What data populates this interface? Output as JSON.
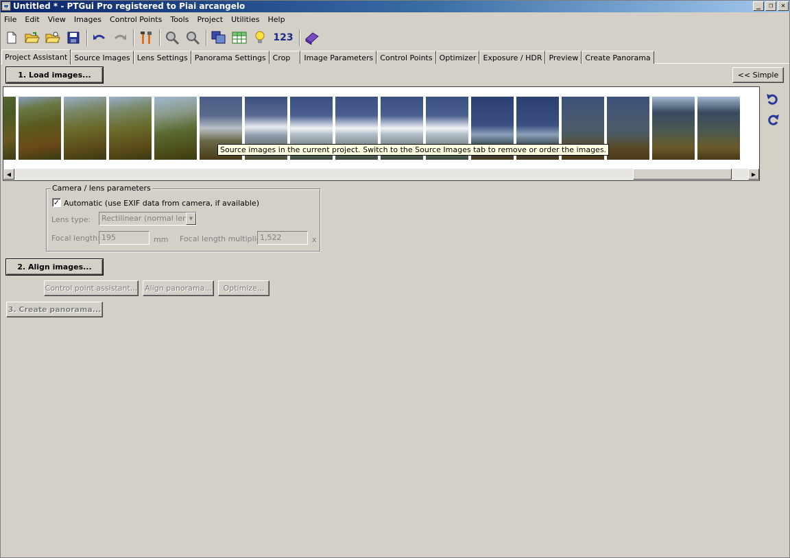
{
  "window": {
    "title": "Untitled * - PTGui Pro registered to Piai arcangelo",
    "controls": [
      "_",
      "❐",
      "✕"
    ]
  },
  "menu": [
    "File",
    "Edit",
    "View",
    "Images",
    "Control Points",
    "Tools",
    "Project",
    "Utilities",
    "Help"
  ],
  "toolbar": {
    "icons": [
      "new-icon",
      "open-icon",
      "open-recent-icon",
      "save-icon",
      "undo-icon",
      "redo-icon",
      "tools-icon",
      "zoom-in-icon",
      "zoom-out-icon",
      "panorama-editor-icon",
      "table-icon",
      "tips-icon",
      "numbering-icon",
      "help-book-icon"
    ],
    "numbering_label": "123"
  },
  "tabs": [
    "Project Assistant",
    "Source Images",
    "Lens Settings",
    "Panorama Settings",
    "Crop",
    "Image Parameters",
    "Control Points",
    "Optimizer",
    "Exposure / HDR",
    "Preview",
    "Create Panorama"
  ],
  "active_tab": "Project Assistant",
  "buttons": {
    "load_images": "1. Load images...",
    "simple": "<< Simple",
    "align_images": "2. Align images...",
    "control_point_assistant": "Control point assistant...",
    "align_panorama": "Align panorama...",
    "optimize": "Optimize...",
    "create_panorama": "3. Create panorama..."
  },
  "strip": {
    "tooltip": "Source images in the current project. Switch to the Source Images tab to remove or order the images.",
    "thumb_count": 17
  },
  "camera": {
    "group_title": "Camera / lens parameters",
    "automatic_label": "Automatic (use EXIF data from camera, if available)",
    "automatic_checked": true,
    "lens_type_label": "Lens type:",
    "lens_type_value": "Rectilinear (normal lens)",
    "focal_length_label": "Focal length:",
    "focal_length_value": "195",
    "focal_length_unit": "mm",
    "multiplier_label": "Focal length multiplier:",
    "multiplier_value": "1,522",
    "multiplier_unit": "x"
  }
}
